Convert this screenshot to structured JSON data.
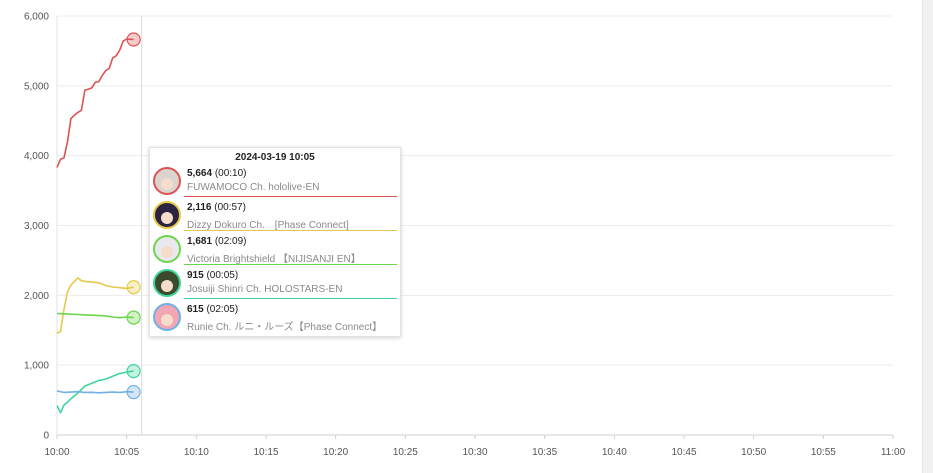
{
  "chart_data": {
    "type": "line",
    "title": "",
    "xlabel": "",
    "ylabel": "",
    "ylim": [
      0,
      6000
    ],
    "yticks": [
      0,
      1000,
      2000,
      3000,
      4000,
      5000,
      6000
    ],
    "ytick_labels": [
      "0",
      "1,000",
      "2,000",
      "3,000",
      "4,000",
      "5,000",
      "6,000"
    ],
    "xlim": [
      "10:00",
      "11:00"
    ],
    "xtick_labels": [
      "10:00",
      "10:05",
      "10:10",
      "10:15",
      "10:20",
      "10:25",
      "10:30",
      "10:35",
      "10:40",
      "10:45",
      "10:50",
      "10:55",
      "11:00"
    ],
    "grid": true,
    "hover_time": "10:05",
    "series": [
      {
        "name": "FUWAMOCO Ch. hololive-EN",
        "color": "#e05252",
        "x": [
          "10:00:00",
          "10:00:15",
          "10:00:30",
          "10:00:45",
          "10:01:00",
          "10:01:15",
          "10:01:30",
          "10:01:45",
          "10:02:00",
          "10:02:15",
          "10:02:30",
          "10:02:45",
          "10:03:00",
          "10:03:15",
          "10:03:30",
          "10:03:45",
          "10:04:00",
          "10:04:15",
          "10:04:30",
          "10:04:45",
          "10:05:00",
          "10:05:30"
        ],
        "values": [
          3830,
          3950,
          3970,
          4200,
          4530,
          4580,
          4620,
          4650,
          4940,
          4950,
          4970,
          5050,
          5060,
          5150,
          5220,
          5250,
          5400,
          5430,
          5510,
          5640,
          5670,
          5664
        ]
      },
      {
        "name": "Dizzy Dokuro Ch.　[Phase Connect]",
        "color": "#e6c94a",
        "x": [
          "10:00:00",
          "10:00:15",
          "10:00:30",
          "10:00:45",
          "10:01:00",
          "10:01:15",
          "10:01:30",
          "10:01:45",
          "10:02:00",
          "10:02:30",
          "10:03:00",
          "10:03:30",
          "10:04:00",
          "10:04:30",
          "10:05:00",
          "10:05:30"
        ],
        "values": [
          1460,
          1480,
          1800,
          2050,
          2150,
          2200,
          2250,
          2210,
          2200,
          2190,
          2180,
          2140,
          2120,
          2110,
          2100,
          2116
        ]
      },
      {
        "name": "Victoria Brightshield 【NIJISANJI EN】",
        "color": "#6ad64a",
        "x": [
          "10:00:00",
          "10:00:30",
          "10:01:00",
          "10:01:30",
          "10:02:00",
          "10:02:30",
          "10:03:00",
          "10:03:30",
          "10:04:00",
          "10:04:30",
          "10:05:00",
          "10:05:30"
        ],
        "values": [
          1740,
          1735,
          1730,
          1725,
          1720,
          1715,
          1710,
          1705,
          1690,
          1680,
          1690,
          1681
        ]
      },
      {
        "name": "Josuiji Shinri Ch. HOLOSTARS-EN",
        "color": "#3ed39a",
        "x": [
          "10:00:00",
          "10:00:15",
          "10:00:30",
          "10:00:45",
          "10:01:00",
          "10:01:15",
          "10:01:30",
          "10:01:45",
          "10:02:00",
          "10:02:30",
          "10:03:00",
          "10:03:30",
          "10:04:00",
          "10:04:30",
          "10:05:00",
          "10:05:30"
        ],
        "values": [
          420,
          320,
          430,
          470,
          520,
          560,
          600,
          650,
          700,
          740,
          780,
          800,
          840,
          880,
          900,
          915
        ]
      },
      {
        "name": "Runie Ch. ルニ・ルーズ【Phase Connect】",
        "color": "#6fb0e6",
        "x": [
          "10:00:00",
          "10:00:30",
          "10:01:00",
          "10:01:30",
          "10:02:00",
          "10:02:30",
          "10:03:00",
          "10:03:30",
          "10:04:00",
          "10:04:30",
          "10:05:00",
          "10:05:30"
        ],
        "values": [
          630,
          610,
          615,
          620,
          610,
          612,
          605,
          610,
          615,
          610,
          620,
          615
        ]
      }
    ]
  },
  "tooltip": {
    "title": "2024-03-19 10:05",
    "rows": [
      {
        "value": "5,664",
        "duration": "(00:10)",
        "name": "FUWAMOCO Ch. hololive-EN",
        "color": "#e05252"
      },
      {
        "value": "2,116",
        "duration": "(00:57)",
        "name": "Dizzy Dokuro Ch.　[Phase Connect]",
        "color": "#e6c94a"
      },
      {
        "value": "1,681",
        "duration": "(02:09)",
        "name": "Victoria Brightshield 【NIJISANJI EN】",
        "color": "#6ad64a"
      },
      {
        "value": "915",
        "duration": "(00:05)",
        "name": "Josuiji Shinri Ch. HOLOSTARS-EN",
        "color": "#3ed39a"
      },
      {
        "value": "615",
        "duration": "(02:05)",
        "name": "Runie Ch. ルニ・ルーズ【Phase Connect】",
        "color": "#6fb0e6"
      }
    ]
  }
}
